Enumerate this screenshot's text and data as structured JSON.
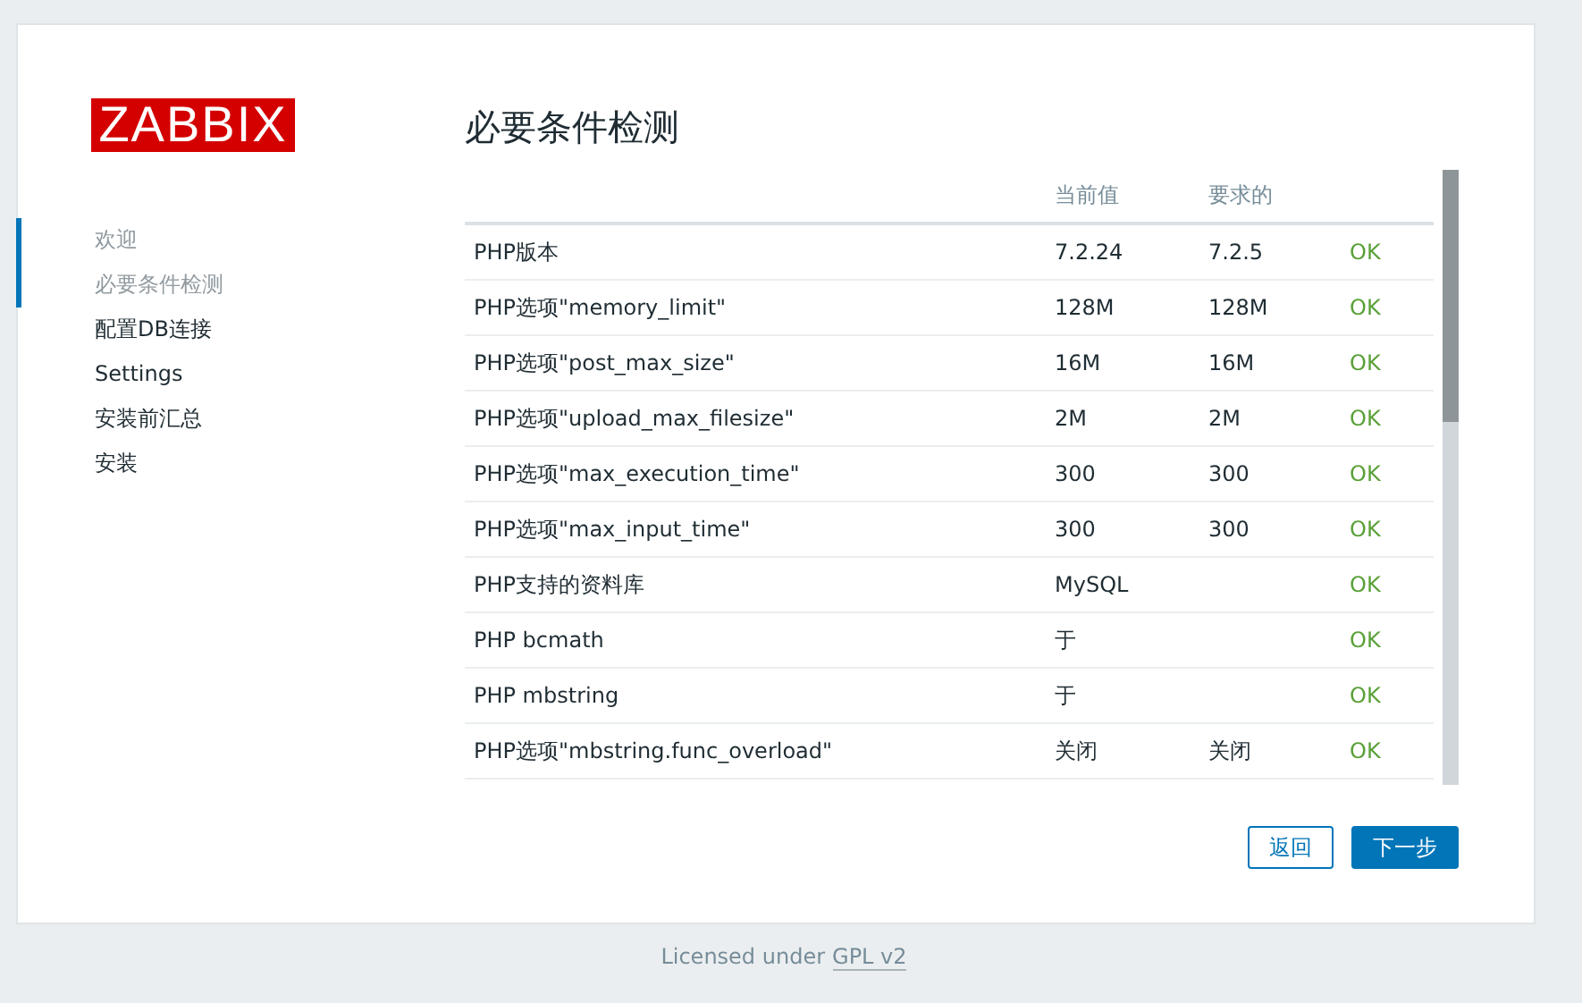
{
  "logo": "ZABBIX",
  "steps": [
    {
      "label": "欢迎",
      "completed": true
    },
    {
      "label": "必要条件检测",
      "completed": true
    },
    {
      "label": "配置DB连接",
      "completed": false
    },
    {
      "label": "Settings",
      "completed": false
    },
    {
      "label": "安装前汇总",
      "completed": false
    },
    {
      "label": "安装",
      "completed": false
    }
  ],
  "title": "必要条件检测",
  "table": {
    "columns": [
      "当前值",
      "要求的"
    ],
    "rows": [
      {
        "name": "PHP版本",
        "current": "7.2.24",
        "required": "7.2.5",
        "status": "OK",
        "ok": true
      },
      {
        "name": "PHP选项\"memory_limit\"",
        "current": "128M",
        "required": "128M",
        "status": "OK",
        "ok": true
      },
      {
        "name": "PHP选项\"post_max_size\"",
        "current": "16M",
        "required": "16M",
        "status": "OK",
        "ok": true
      },
      {
        "name": "PHP选项\"upload_max_filesize\"",
        "current": "2M",
        "required": "2M",
        "status": "OK",
        "ok": true
      },
      {
        "name": "PHP选项\"max_execution_time\"",
        "current": "300",
        "required": "300",
        "status": "OK",
        "ok": true
      },
      {
        "name": "PHP选项\"max_input_time\"",
        "current": "300",
        "required": "300",
        "status": "OK",
        "ok": true
      },
      {
        "name": "PHP支持的资料库",
        "current": "MySQL",
        "required": "",
        "status": "OK",
        "ok": true
      },
      {
        "name": "PHP bcmath",
        "current": "于",
        "required": "",
        "status": "OK",
        "ok": true
      },
      {
        "name": "PHP mbstring",
        "current": "于",
        "required": "",
        "status": "OK",
        "ok": true
      },
      {
        "name": "PHP选项\"mbstring.func_overload\"",
        "current": "关闭",
        "required": "关闭",
        "status": "OK",
        "ok": true
      }
    ]
  },
  "buttons": {
    "back": "返回",
    "next": "下一步"
  },
  "footer": {
    "text": "Licensed under",
    "link": "GPL v2"
  }
}
